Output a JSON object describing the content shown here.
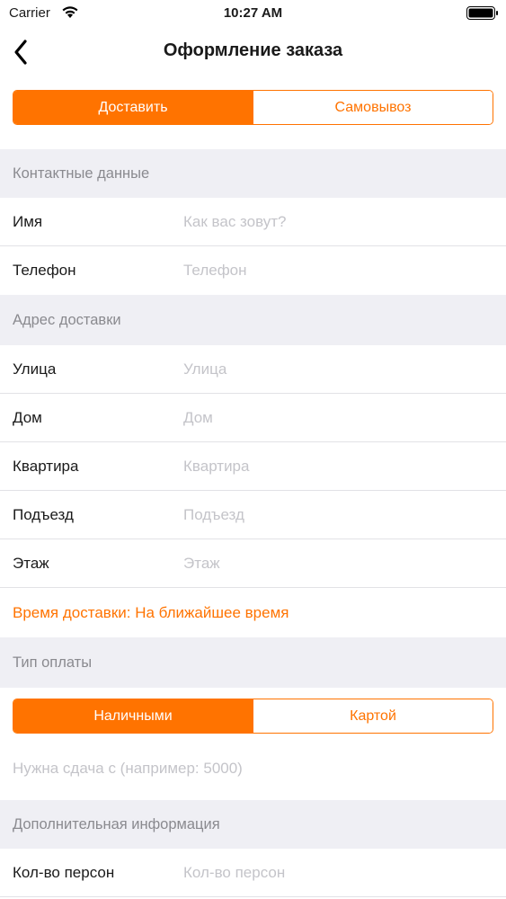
{
  "status_bar": {
    "carrier": "Carrier",
    "time": "10:27 AM"
  },
  "nav": {
    "title": "Оформление заказа",
    "back_icon": "chevron-left-icon"
  },
  "delivery_mode": {
    "options": [
      "Доставить",
      "Самовывоз"
    ],
    "selected": "Доставить"
  },
  "contact": {
    "header": "Контактные данные",
    "fields": [
      {
        "label": "Имя",
        "placeholder": "Как вас зовут?",
        "value": ""
      },
      {
        "label": "Телефон",
        "placeholder": "Телефон",
        "value": ""
      }
    ]
  },
  "address": {
    "header": "Адрес доставки",
    "fields": [
      {
        "label": "Улица",
        "placeholder": "Улица",
        "value": ""
      },
      {
        "label": "Дом",
        "placeholder": "Дом",
        "value": ""
      },
      {
        "label": "Квартира",
        "placeholder": "Квартира",
        "value": ""
      },
      {
        "label": "Подъезд",
        "placeholder": "Подъезд",
        "value": ""
      },
      {
        "label": "Этаж",
        "placeholder": "Этаж",
        "value": ""
      }
    ],
    "delivery_time": "Время доставки: На ближайшее время"
  },
  "payment": {
    "header": "Тип оплаты",
    "options": [
      "Наличными",
      "Картой"
    ],
    "selected": "Наличными",
    "change_placeholder": "Нужна сдача с (например: 5000)"
  },
  "extra": {
    "header": "Дополнительная информация",
    "fields": [
      {
        "label": "Кол-во персон",
        "placeholder": "Кол-во персон",
        "value": ""
      }
    ]
  },
  "colors": {
    "accent": "#ff7300",
    "section_bg": "#efeff4",
    "placeholder": "#c4c4c9"
  }
}
